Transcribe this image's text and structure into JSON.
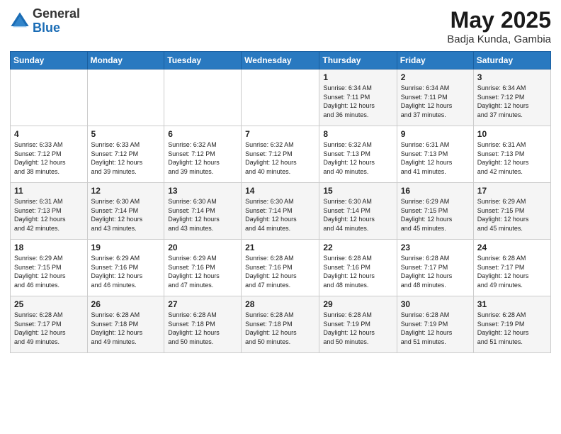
{
  "logo": {
    "general": "General",
    "blue": "Blue"
  },
  "title": "May 2025",
  "subtitle": "Badja Kunda, Gambia",
  "days_of_week": [
    "Sunday",
    "Monday",
    "Tuesday",
    "Wednesday",
    "Thursday",
    "Friday",
    "Saturday"
  ],
  "weeks": [
    [
      {
        "day": "",
        "detail": ""
      },
      {
        "day": "",
        "detail": ""
      },
      {
        "day": "",
        "detail": ""
      },
      {
        "day": "",
        "detail": ""
      },
      {
        "day": "1",
        "detail": "Sunrise: 6:34 AM\nSunset: 7:11 PM\nDaylight: 12 hours\nand 36 minutes."
      },
      {
        "day": "2",
        "detail": "Sunrise: 6:34 AM\nSunset: 7:11 PM\nDaylight: 12 hours\nand 37 minutes."
      },
      {
        "day": "3",
        "detail": "Sunrise: 6:34 AM\nSunset: 7:12 PM\nDaylight: 12 hours\nand 37 minutes."
      }
    ],
    [
      {
        "day": "4",
        "detail": "Sunrise: 6:33 AM\nSunset: 7:12 PM\nDaylight: 12 hours\nand 38 minutes."
      },
      {
        "day": "5",
        "detail": "Sunrise: 6:33 AM\nSunset: 7:12 PM\nDaylight: 12 hours\nand 39 minutes."
      },
      {
        "day": "6",
        "detail": "Sunrise: 6:32 AM\nSunset: 7:12 PM\nDaylight: 12 hours\nand 39 minutes."
      },
      {
        "day": "7",
        "detail": "Sunrise: 6:32 AM\nSunset: 7:12 PM\nDaylight: 12 hours\nand 40 minutes."
      },
      {
        "day": "8",
        "detail": "Sunrise: 6:32 AM\nSunset: 7:13 PM\nDaylight: 12 hours\nand 40 minutes."
      },
      {
        "day": "9",
        "detail": "Sunrise: 6:31 AM\nSunset: 7:13 PM\nDaylight: 12 hours\nand 41 minutes."
      },
      {
        "day": "10",
        "detail": "Sunrise: 6:31 AM\nSunset: 7:13 PM\nDaylight: 12 hours\nand 42 minutes."
      }
    ],
    [
      {
        "day": "11",
        "detail": "Sunrise: 6:31 AM\nSunset: 7:13 PM\nDaylight: 12 hours\nand 42 minutes."
      },
      {
        "day": "12",
        "detail": "Sunrise: 6:30 AM\nSunset: 7:14 PM\nDaylight: 12 hours\nand 43 minutes."
      },
      {
        "day": "13",
        "detail": "Sunrise: 6:30 AM\nSunset: 7:14 PM\nDaylight: 12 hours\nand 43 minutes."
      },
      {
        "day": "14",
        "detail": "Sunrise: 6:30 AM\nSunset: 7:14 PM\nDaylight: 12 hours\nand 44 minutes."
      },
      {
        "day": "15",
        "detail": "Sunrise: 6:30 AM\nSunset: 7:14 PM\nDaylight: 12 hours\nand 44 minutes."
      },
      {
        "day": "16",
        "detail": "Sunrise: 6:29 AM\nSunset: 7:15 PM\nDaylight: 12 hours\nand 45 minutes."
      },
      {
        "day": "17",
        "detail": "Sunrise: 6:29 AM\nSunset: 7:15 PM\nDaylight: 12 hours\nand 45 minutes."
      }
    ],
    [
      {
        "day": "18",
        "detail": "Sunrise: 6:29 AM\nSunset: 7:15 PM\nDaylight: 12 hours\nand 46 minutes."
      },
      {
        "day": "19",
        "detail": "Sunrise: 6:29 AM\nSunset: 7:16 PM\nDaylight: 12 hours\nand 46 minutes."
      },
      {
        "day": "20",
        "detail": "Sunrise: 6:29 AM\nSunset: 7:16 PM\nDaylight: 12 hours\nand 47 minutes."
      },
      {
        "day": "21",
        "detail": "Sunrise: 6:28 AM\nSunset: 7:16 PM\nDaylight: 12 hours\nand 47 minutes."
      },
      {
        "day": "22",
        "detail": "Sunrise: 6:28 AM\nSunset: 7:16 PM\nDaylight: 12 hours\nand 48 minutes."
      },
      {
        "day": "23",
        "detail": "Sunrise: 6:28 AM\nSunset: 7:17 PM\nDaylight: 12 hours\nand 48 minutes."
      },
      {
        "day": "24",
        "detail": "Sunrise: 6:28 AM\nSunset: 7:17 PM\nDaylight: 12 hours\nand 49 minutes."
      }
    ],
    [
      {
        "day": "25",
        "detail": "Sunrise: 6:28 AM\nSunset: 7:17 PM\nDaylight: 12 hours\nand 49 minutes."
      },
      {
        "day": "26",
        "detail": "Sunrise: 6:28 AM\nSunset: 7:18 PM\nDaylight: 12 hours\nand 49 minutes."
      },
      {
        "day": "27",
        "detail": "Sunrise: 6:28 AM\nSunset: 7:18 PM\nDaylight: 12 hours\nand 50 minutes."
      },
      {
        "day": "28",
        "detail": "Sunrise: 6:28 AM\nSunset: 7:18 PM\nDaylight: 12 hours\nand 50 minutes."
      },
      {
        "day": "29",
        "detail": "Sunrise: 6:28 AM\nSunset: 7:19 PM\nDaylight: 12 hours\nand 50 minutes."
      },
      {
        "day": "30",
        "detail": "Sunrise: 6:28 AM\nSunset: 7:19 PM\nDaylight: 12 hours\nand 51 minutes."
      },
      {
        "day": "31",
        "detail": "Sunrise: 6:28 AM\nSunset: 7:19 PM\nDaylight: 12 hours\nand 51 minutes."
      }
    ]
  ]
}
